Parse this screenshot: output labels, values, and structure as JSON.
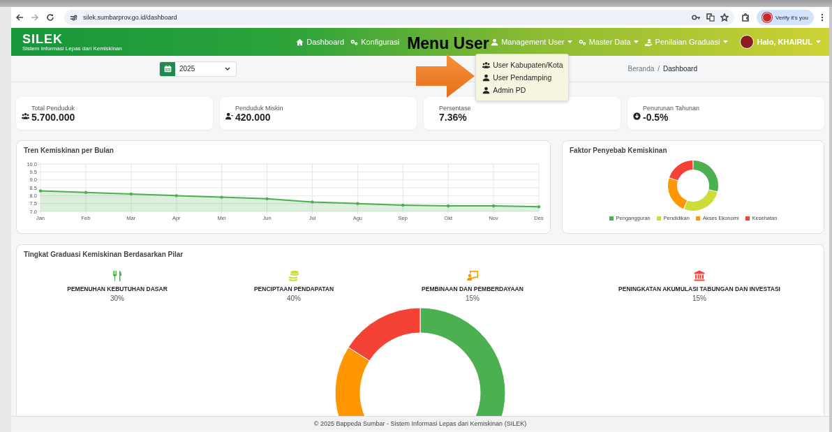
{
  "browser": {
    "url": "silek.sumbarprov.go.id/dashboard",
    "profile_button": "Verify it's you"
  },
  "navbar": {
    "logo": "SILEK",
    "logo_subtitle": "Sistem Informasi Lepas dari Kemiskinan",
    "items": [
      {
        "label": "Dashboard",
        "kind": "home",
        "has_caret": false
      },
      {
        "label": "Konfigurasi",
        "kind": "gears",
        "has_caret": false
      },
      {
        "label": "Management User",
        "kind": "person",
        "has_caret": true,
        "expanded": true,
        "menu": [
          {
            "label": "User Kabupaten/Kota",
            "kind": "people"
          },
          {
            "label": "User Pendamping",
            "kind": "person"
          },
          {
            "label": "Admin PD",
            "kind": "person"
          }
        ]
      },
      {
        "label": "Master Data",
        "kind": "gears",
        "has_caret": true
      },
      {
        "label": "Penilaian Graduasi",
        "kind": "hand",
        "has_caret": true
      }
    ],
    "user": {
      "greeting": "Halo, KHAIRUL"
    }
  },
  "annotation": {
    "label": "Menu User"
  },
  "filter": {
    "year": "2025"
  },
  "breadcrumb": {
    "items": [
      "Beranda",
      "Dashboard"
    ],
    "separator": "/"
  },
  "stats": [
    {
      "label": "Total Penduduk",
      "value": "5.700.000",
      "kind": "people"
    },
    {
      "label": "Penduduk Miskin",
      "value": "420.000",
      "kind": "person-minus"
    },
    {
      "label": "Persentase",
      "value": "7.36%",
      "kind": "plain"
    },
    {
      "label": "Penurunan Tahunan",
      "value": "-0.5%",
      "kind": "down"
    }
  ],
  "trend": {
    "title": "Tren Kemiskinan per Bulan",
    "chart_data": {
      "type": "area",
      "grid": true,
      "categories": [
        "Jan",
        "Feb",
        "Mar",
        "Apr",
        "Mei",
        "Jun",
        "Jul",
        "Agu",
        "Sep",
        "Okt",
        "Nov",
        "Des"
      ],
      "series": [
        {
          "color": "#4caf50",
          "values": [
            8.3,
            8.2,
            8.1,
            8.0,
            7.9,
            7.8,
            7.6,
            7.5,
            7.4,
            7.35,
            7.35,
            7.3
          ]
        }
      ],
      "ylim": [
        7,
        10
      ],
      "yticks": [
        {
          "value": 7,
          "label": "7.0"
        },
        {
          "value": 7.5,
          "label": "7.5"
        },
        {
          "value": 8,
          "label": "8.0"
        },
        {
          "value": 8.5,
          "label": "8.5"
        },
        {
          "value": 9,
          "label": "9.0"
        },
        {
          "value": 9.5,
          "label": "9.5"
        },
        {
          "value": 10,
          "label": "10.0"
        }
      ]
    }
  },
  "causes": {
    "title": "Faktor Penyebab Kemiskinan",
    "legend": [
      {
        "label": "Pengangguran",
        "color": "#4caf50"
      },
      {
        "label": "Pendidikan",
        "color": "#cddc39"
      },
      {
        "label": "Akses Ekonomi",
        "color": "#ff9800"
      },
      {
        "label": "Kesehatan",
        "color": "#f44336"
      }
    ]
  },
  "pillars": {
    "title": "Tingkat Graduasi Kemiskinan Berdasarkan Pilar",
    "items": [
      {
        "label": "PEMENUHAN KEBUTUHAN DASAR",
        "value": "30%",
        "kind": "utensils",
        "color": "#4caf50"
      },
      {
        "label": "PENCIPTAAN PENDAPATAN",
        "value": "40%",
        "kind": "coins",
        "color": "#cddc39"
      },
      {
        "label": "PEMBINAAN DAN PEMBERDAYAAN",
        "value": "15%",
        "kind": "presenter",
        "color": "#ff9800"
      },
      {
        "label": "PENINGKATAN AKUMULASI TABUNGAN DAN INVESTASI",
        "value": "15%",
        "kind": "bank",
        "color": "#f44336"
      }
    ]
  },
  "footer": {
    "text": "© 2025 Bappeda Sumbar - Sistem Informasi Lepas dari Kemiskinan (SILEK)"
  }
}
